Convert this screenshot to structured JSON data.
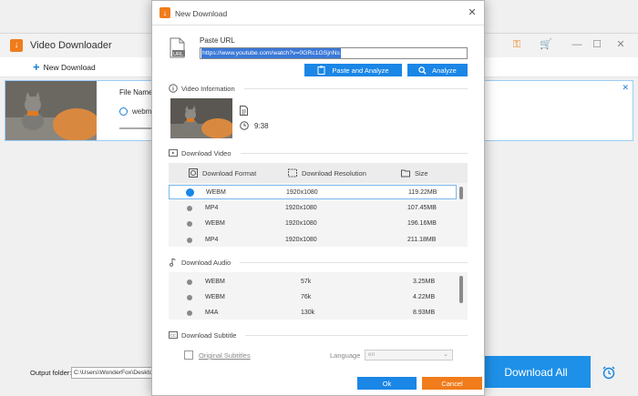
{
  "app": {
    "title": "Video Downloader",
    "toolbar": {
      "new_download_label": "New Download"
    },
    "list": {
      "file_name_label": "File Name:",
      "format": "webm"
    },
    "bottom": {
      "output_label": "Output folder:",
      "output_path": "C:\\Users\\WonderFox\\Desktop",
      "download_all_label": "Download All"
    },
    "colors": {
      "accent": "#1a86e6",
      "brand": "#f07c1b"
    }
  },
  "dialog": {
    "title": "New Download",
    "paste_url_label": "Paste URL",
    "url_value": "https://www.youtube.com/watch?v=0GRc1GSjnNs",
    "paste_analyze_label": "Paste and Analyze",
    "analyze_label": "Analyze",
    "video_info": {
      "heading": "Video Information",
      "duration": "9:38"
    },
    "download_video": {
      "heading": "Download Video",
      "headers": [
        "Download Format",
        "Download Resolution",
        "Size"
      ],
      "rows": [
        {
          "format": "WEBM",
          "resolution": "1920x1080",
          "size": "119.22MB",
          "selected": true
        },
        {
          "format": "MP4",
          "resolution": "1920x1080",
          "size": "107.45MB",
          "selected": false
        },
        {
          "format": "WEBM",
          "resolution": "1920x1080",
          "size": "196.16MB",
          "selected": false
        },
        {
          "format": "MP4",
          "resolution": "1920x1080",
          "size": "211.18MB",
          "selected": false
        }
      ]
    },
    "download_audio": {
      "heading": "Download Audio",
      "rows": [
        {
          "format": "WEBM",
          "bitrate": "57k",
          "size": "3.25MB"
        },
        {
          "format": "WEBM",
          "bitrate": "76k",
          "size": "4.22MB"
        },
        {
          "format": "M4A",
          "bitrate": "130k",
          "size": "8.93MB"
        }
      ]
    },
    "download_subtitle": {
      "heading": "Download Subtitle",
      "original_label": "Original Subtitles",
      "language_label": "Language",
      "language_value": "en"
    },
    "ok_label": "Ok",
    "cancel_label": "Cancel"
  }
}
